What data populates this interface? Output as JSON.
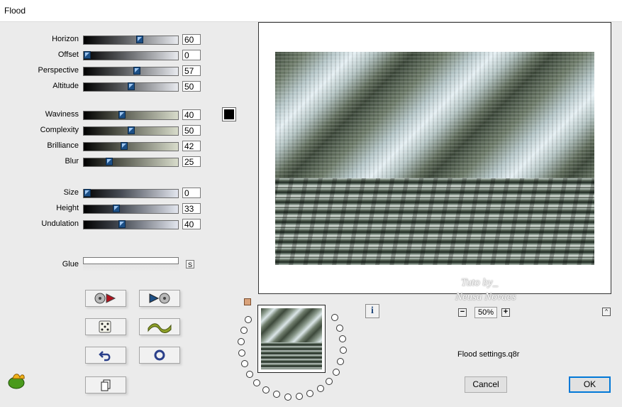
{
  "window": {
    "title": "Flood"
  },
  "sliders_group1": [
    {
      "name": "horizon",
      "label": "Horizon",
      "value": "60",
      "fraction": 0.6
    },
    {
      "name": "offset",
      "label": "Offset",
      "value": "0",
      "fraction": 0.0
    },
    {
      "name": "perspective",
      "label": "Perspective",
      "value": "57",
      "fraction": 0.57
    },
    {
      "name": "altitude",
      "label": "Altitude",
      "value": "50",
      "fraction": 0.5
    }
  ],
  "sliders_group2": [
    {
      "name": "waviness",
      "label": "Waviness",
      "value": "40",
      "fraction": 0.4
    },
    {
      "name": "complexity",
      "label": "Complexity",
      "value": "50",
      "fraction": 0.5
    },
    {
      "name": "brilliance",
      "label": "Brilliance",
      "value": "42",
      "fraction": 0.42
    },
    {
      "name": "blur",
      "label": "Blur",
      "value": "25",
      "fraction": 0.25
    }
  ],
  "sliders_group3": [
    {
      "name": "size",
      "label": "Size",
      "value": "0",
      "fraction": 0.0
    },
    {
      "name": "height",
      "label": "Height",
      "value": "33",
      "fraction": 0.33
    },
    {
      "name": "undulation",
      "label": "Undulation",
      "value": "40",
      "fraction": 0.4
    }
  ],
  "glue": {
    "label": "Glue",
    "lock_label": "S"
  },
  "color_swatch": "#000000",
  "zoom": {
    "value": "50%",
    "minus": "−",
    "plus": "+"
  },
  "info_label": "i",
  "up_label": "^",
  "filename": "Flood settings.q8r",
  "buttons": {
    "cancel": "Cancel",
    "ok": "OK"
  },
  "watermark": {
    "line1": "Tuto by_",
    "line2": "Neusa Novaes"
  }
}
